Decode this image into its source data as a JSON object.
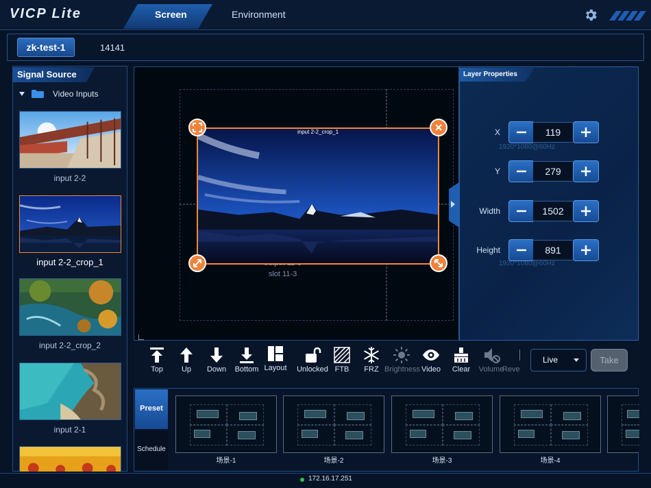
{
  "app": {
    "title": "VICP Lite"
  },
  "nav": {
    "tabs": [
      {
        "label": "Screen",
        "active": true
      },
      {
        "label": "Environment",
        "active": false
      }
    ],
    "settings_icon": "gear-icon"
  },
  "screens": [
    {
      "label": "zk-test-1",
      "selected": true
    },
    {
      "label": "14141",
      "selected": false
    }
  ],
  "signal_source": {
    "title": "Signal Source",
    "folder_label": "Video Inputs",
    "items": [
      {
        "label": "input 2-2",
        "selected": false
      },
      {
        "label": "input 2-2_crop_1",
        "selected": true
      },
      {
        "label": "input 2-2_crop_2",
        "selected": false
      },
      {
        "label": "input 2-1",
        "selected": false
      }
    ]
  },
  "canvas": {
    "layer_name": "input 2-2_crop_1",
    "output_label": "output 11-3",
    "slot_label": "slot 11-3"
  },
  "layer_properties": {
    "title": "Layer Properties",
    "fields": [
      {
        "label": "X",
        "value": "119"
      },
      {
        "label": "Y",
        "value": "279"
      },
      {
        "label": "Width",
        "value": "1502"
      },
      {
        "label": "Height",
        "value": "891"
      }
    ],
    "ghost_text": "1920*1080@60Hz"
  },
  "toolbar": {
    "tools": [
      {
        "label": "Top",
        "icon": "bring-to-top-icon"
      },
      {
        "label": "Up",
        "icon": "move-up-icon"
      },
      {
        "label": "Down",
        "icon": "move-down-icon"
      },
      {
        "label": "Bottom",
        "icon": "send-to-bottom-icon"
      },
      {
        "label": "Layout",
        "icon": "layout-icon"
      },
      {
        "label": "Unlocked",
        "icon": "unlock-icon"
      },
      {
        "label": "FTB",
        "icon": "ftb-icon"
      },
      {
        "label": "FRZ",
        "icon": "snowflake-icon"
      },
      {
        "label": "Brightness",
        "icon": "sun-icon"
      },
      {
        "label": "Video",
        "icon": "eye-icon"
      },
      {
        "label": "Clear",
        "icon": "broom-icon"
      },
      {
        "label": "Volume",
        "icon": "mute-icon"
      },
      {
        "label": "Reve",
        "icon": "reverse-icon"
      }
    ],
    "mode_select": "Live",
    "take_label": "Take"
  },
  "presets": {
    "tabs": [
      {
        "label": "Preset",
        "active": true
      },
      {
        "label": "Schedule",
        "active": false
      }
    ],
    "items": [
      {
        "label": "场景-1"
      },
      {
        "label": "场景-2"
      },
      {
        "label": "场景-3"
      },
      {
        "label": "场景-4"
      }
    ]
  },
  "status": {
    "ip": "172.16.17.251",
    "connected": true
  },
  "colors": {
    "accent": "#1f5fae",
    "selection": "#f08a3a",
    "online": "#35c24a",
    "background": "#071326"
  }
}
